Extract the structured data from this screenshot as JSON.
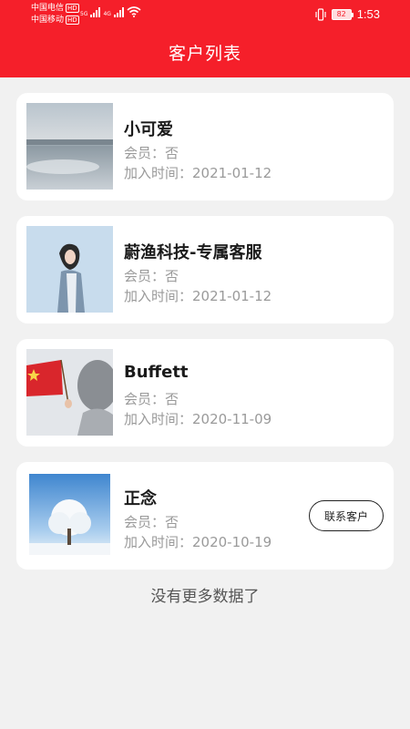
{
  "status_bar": {
    "carrier_1": "中国电信",
    "carrier_2": "中国移动",
    "hd_label": "HD",
    "net_5g": "5G",
    "net_4g": "4G",
    "battery": "82",
    "time": "1:53"
  },
  "header": {
    "title": "客户列表"
  },
  "customers": [
    {
      "name": "小可爱",
      "member": "会员：否",
      "joined": "加入时间：2021-01-12",
      "avatar_icon": "landscape-photo-icon"
    },
    {
      "name": "蔚渔科技-专属客服",
      "member": "会员：否",
      "joined": "加入时间：2021-01-12",
      "avatar_icon": "portrait-photo-icon"
    },
    {
      "name": "Buffett",
      "member": "会员：否",
      "joined": "加入时间：2020-11-09",
      "avatar_icon": "flag-photo-icon"
    },
    {
      "name": "正念",
      "member": "会员：否",
      "joined": "加入时间：2020-10-19",
      "avatar_icon": "tree-photo-icon",
      "action_label": "联系客户"
    }
  ],
  "footer": {
    "no_more_text": "没有更多数据了"
  },
  "colors": {
    "header_bg": "#f51f2a",
    "page_bg": "#f1f1f1",
    "card_bg": "#ffffff",
    "muted_text": "#9a9a9a"
  }
}
